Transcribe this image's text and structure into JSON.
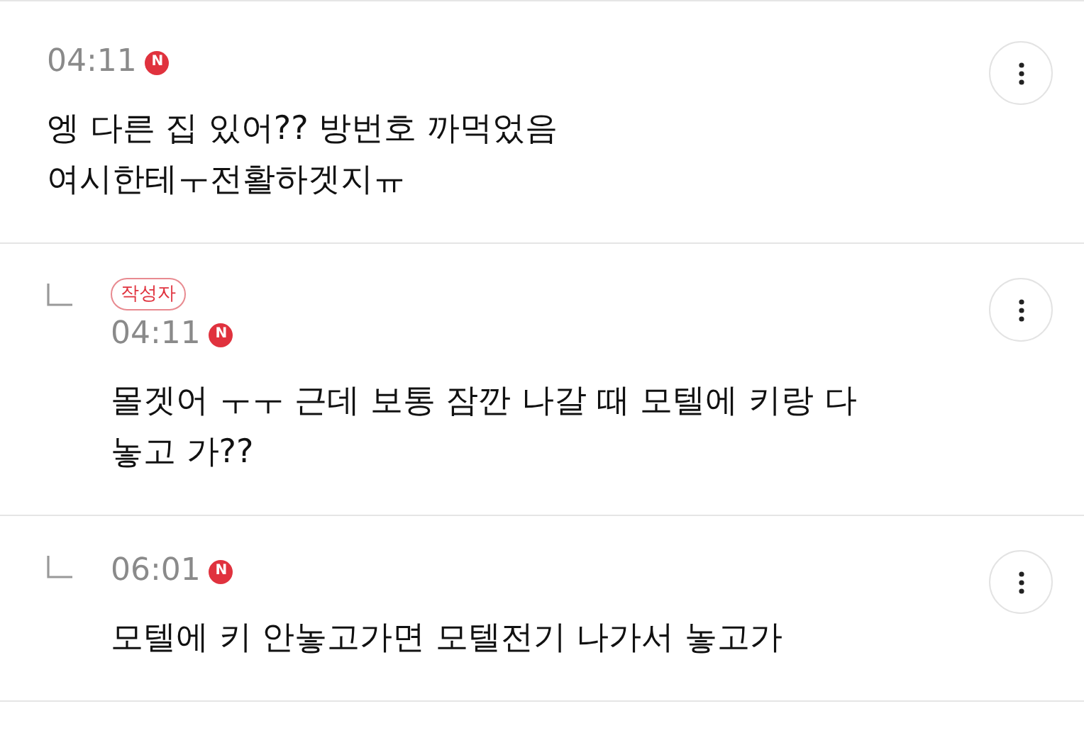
{
  "comments": [
    {
      "kind": "comment",
      "time": "04:11",
      "new_badge": "N",
      "text": "엥 다른 집 있어?? 방번호 까먹었음\n여시한테ㅜ전활하겟지ㅠ"
    },
    {
      "kind": "reply",
      "author_tag": "작성자",
      "time": "04:11",
      "new_badge": "N",
      "text": "몰겟어 ㅜㅜ 근데 보통 잠깐 나갈 때 모텔에 키랑 다\n놓고 가??"
    },
    {
      "kind": "reply",
      "time": "06:01",
      "new_badge": "N",
      "text": "모텔에 키 안놓고가면 모텔전기 나가서 놓고가"
    }
  ]
}
